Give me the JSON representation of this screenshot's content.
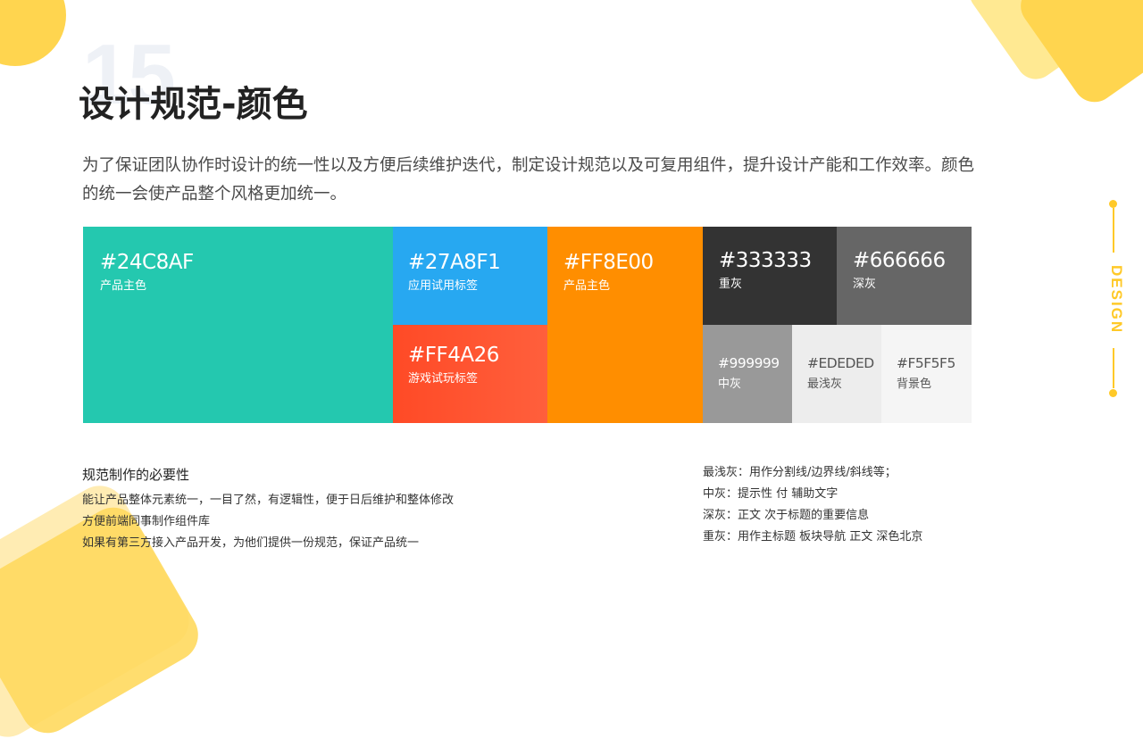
{
  "page": {
    "number": "15",
    "title": "设计规范-颜色",
    "intro": "为了保证团队协作时设计的统一性以及方便后续维护迭代，制定设计规范以及可复用组件，提升设计产能和工作效率。颜色的统一会使产品整个风格更加统一。",
    "side_label": "DESIGN"
  },
  "palette": [
    {
      "hex": "#24C8AF",
      "role": "产品主色",
      "color": "#24C8AF"
    },
    {
      "hex": "#27A8F1",
      "role": "应用试用标签",
      "color": "#27A8F1"
    },
    {
      "hex": "#FF4A26",
      "role": "游戏试玩标签",
      "color": "#FF4A26"
    },
    {
      "hex": "#FF8E00",
      "role": "产品主色",
      "color": "#FF8E00"
    },
    {
      "hex": "#333333",
      "role": "重灰",
      "color": "#333333"
    },
    {
      "hex": "#666666",
      "role": "深灰",
      "color": "#666666"
    },
    {
      "hex": "#999999",
      "role": "中灰",
      "color": "#999999"
    },
    {
      "hex": "#EDEDED",
      "role": "最浅灰",
      "color": "#EDEDED"
    },
    {
      "hex": "#F5F5F5",
      "role": "背景色",
      "color": "#F5F5F5"
    }
  ],
  "notes": {
    "heading": "规范制作的必要性",
    "lines": [
      "能让产品整体元素统一，一目了然，有逻辑性，便于日后维护和整体修改",
      "方便前端同事制作组件库",
      "如果有第三方接入产品开发，为他们提供一份规范，保证产品统一"
    ]
  },
  "gray_usage": [
    "最浅灰：用作分割线/边界线/斜线等；",
    "中灰：提示性 付 辅助文字",
    "深灰：正文 次于标题的重要信息",
    "重灰：用作主标题  板块导航  正文  深色北京"
  ],
  "accent_colors": {
    "decoration_yellow": "#FFD54F",
    "side_yellow": "#FFC928"
  }
}
